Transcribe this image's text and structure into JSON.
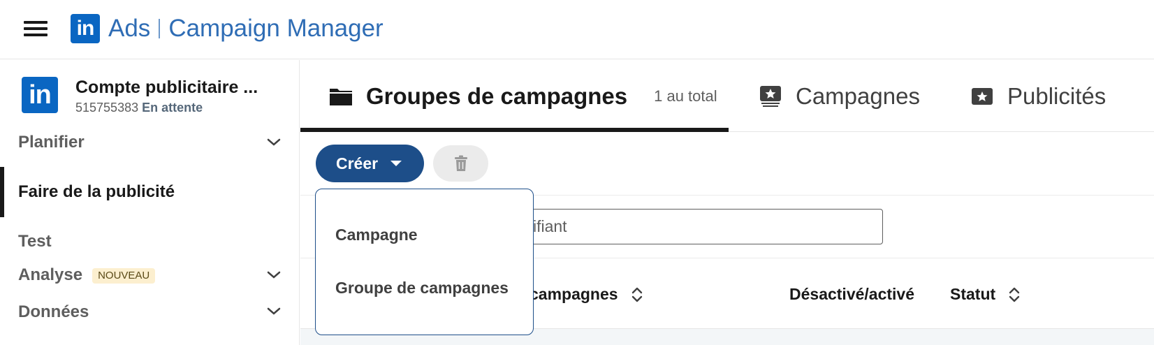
{
  "header": {
    "logo_text": "in",
    "brand_product": "Ads",
    "brand_app": "Campaign Manager"
  },
  "account": {
    "logo_text": "in",
    "name": "Compte publicitaire ...",
    "id": "515755383",
    "status": "En attente"
  },
  "sidebar": {
    "items": [
      {
        "label": "Planifier",
        "has_chevron": true
      },
      {
        "label": "Faire de la publicité",
        "active": true
      },
      {
        "label": "Test"
      },
      {
        "label": "Analyse",
        "badge": "NOUVEAU",
        "has_chevron": true
      },
      {
        "label": "Données",
        "has_chevron": true
      }
    ]
  },
  "tabs": [
    {
      "label": "Groupes de campagnes",
      "count": "1 au total",
      "icon": "folder-icon",
      "active": true
    },
    {
      "label": "Campagnes",
      "icon": "campaign-star-stack-icon"
    },
    {
      "label": "Publicités",
      "icon": "ad-star-icon"
    }
  ],
  "toolbar": {
    "create_label": "Créer",
    "delete_icon": "trash-icon"
  },
  "search": {
    "visible_text": "entifiant"
  },
  "table": {
    "headers": [
      {
        "label": "campagnes",
        "sortable": true
      },
      {
        "label": "Désactivé/activé",
        "sortable": false
      },
      {
        "label": "Statut",
        "sortable": true
      }
    ]
  },
  "create_menu": {
    "items": [
      "Campagne",
      "Groupe de campagnes"
    ]
  },
  "colors": {
    "brand_blue": "#0a66c2",
    "header_text_blue": "#2f6db5",
    "primary_button": "#1d4e89"
  }
}
